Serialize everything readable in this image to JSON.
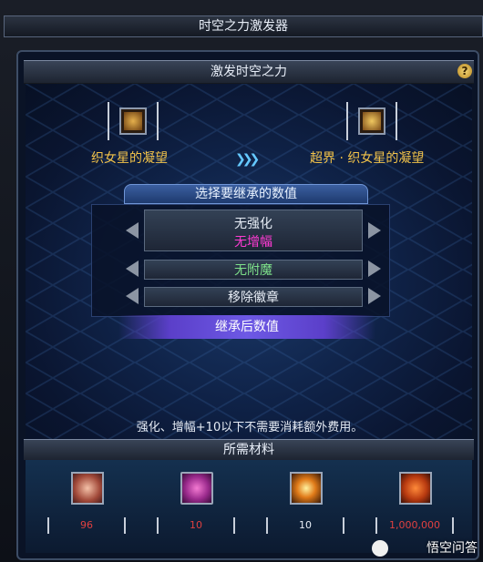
{
  "window": {
    "title": "时空之力激发器"
  },
  "section": {
    "title": "激发时空之力",
    "help": "?"
  },
  "source_item": {
    "name": "织女星的凝望",
    "icon": "amulet-icon"
  },
  "target_item": {
    "name": "超界 · 织女星的凝望",
    "icon": "amulet-icon"
  },
  "inherit": {
    "title": "选择要继承的数值",
    "rows": [
      {
        "line1": "无强化",
        "line2": "无增幅"
      },
      {
        "line1": "无附魔"
      },
      {
        "line1": "移除徽章"
      }
    ],
    "result": "继承后数值"
  },
  "notice": "强化、增幅+10以下不需要消耗额外费用。",
  "materials": {
    "title": "所需材料",
    "items": [
      {
        "icon": "fragment-icon",
        "value": "96",
        "color": "#e04040"
      },
      {
        "icon": "orb-icon",
        "value": "10",
        "color": "#e04040"
      },
      {
        "icon": "ring-rune-icon",
        "value": "10",
        "color": "#e6ecf5"
      },
      {
        "icon": "gold-coins-icon",
        "value": "1,000,000",
        "color": "#e04040"
      }
    ]
  },
  "watermark": "悟空问答",
  "colors": {
    "accent_gold": "#f2c34a",
    "accent_blue": "#64c8ff",
    "magenta": "#ff3bd4",
    "green": "#7ee08a"
  }
}
